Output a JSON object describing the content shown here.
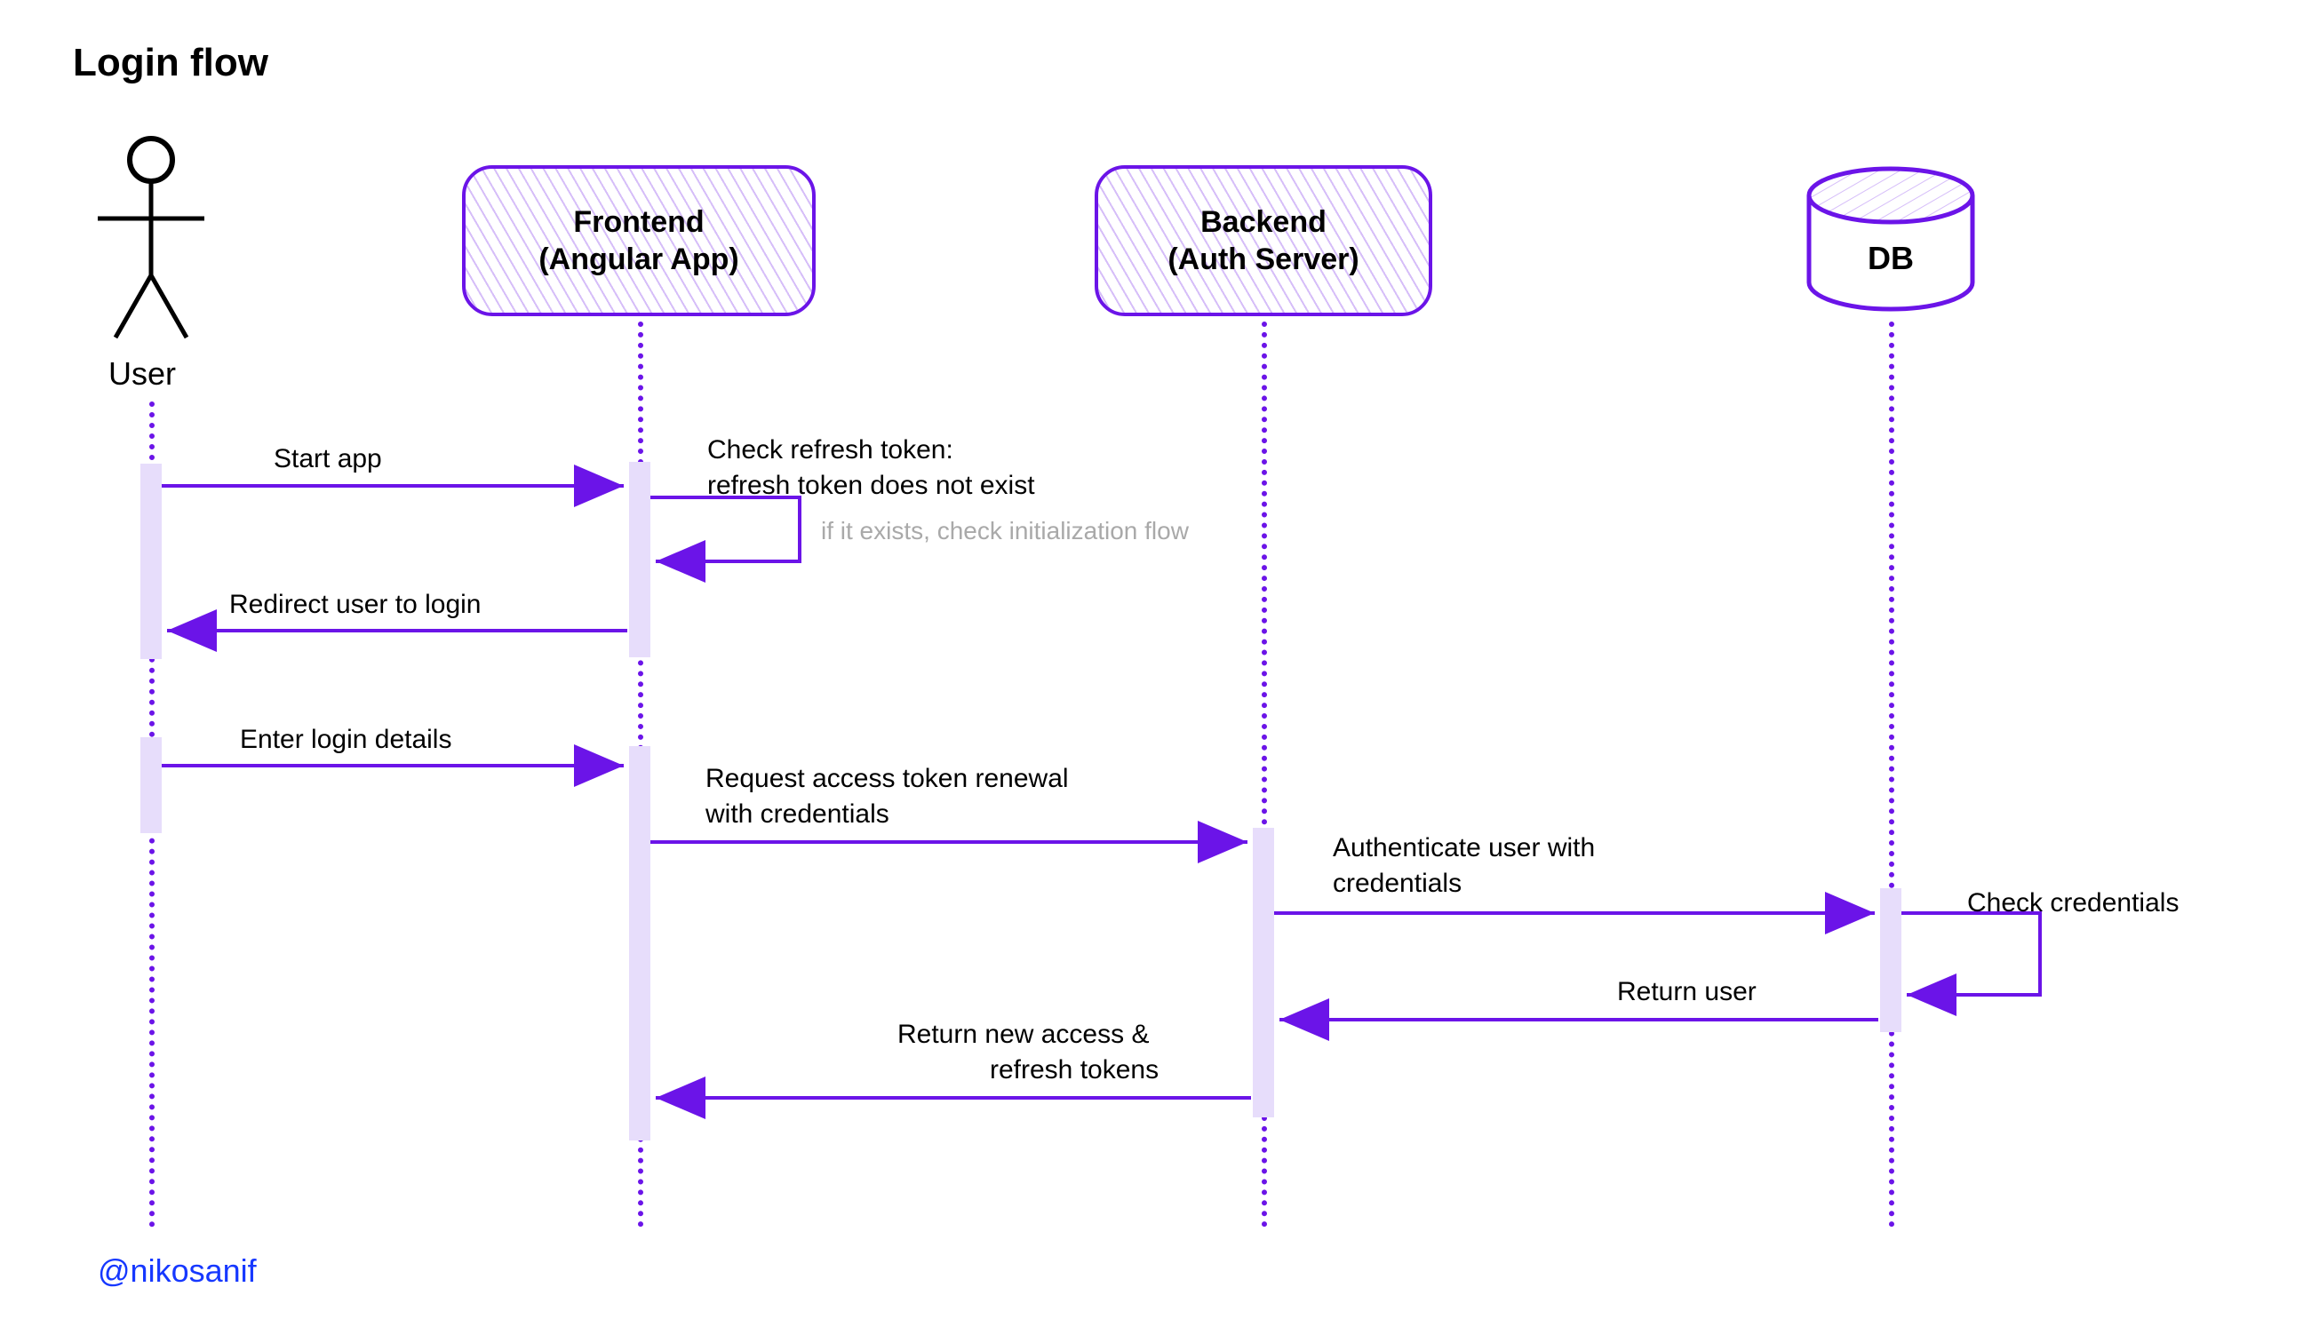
{
  "title": "Login flow",
  "attribution": "@nikosanif",
  "participants": {
    "user": {
      "label": "User"
    },
    "frontend": {
      "line1": "Frontend",
      "line2": "(Angular App)"
    },
    "backend": {
      "line1": "Backend",
      "line2": "(Auth Server)"
    },
    "db": {
      "label": "DB"
    }
  },
  "messages": {
    "m1": "Start app",
    "m2a": "Check refresh token:",
    "m2b": "refresh token does not exist",
    "m2note": "if it exists, check initialization flow",
    "m3": "Redirect user to login",
    "m4": "Enter login details",
    "m5a": "Request access token renewal",
    "m5b": "with credentials",
    "m6a": "Authenticate user with",
    "m6b": "credentials",
    "m7": "Check credentials",
    "m8": "Return user",
    "m9a": "Return new access &",
    "m9b": "refresh tokens"
  }
}
